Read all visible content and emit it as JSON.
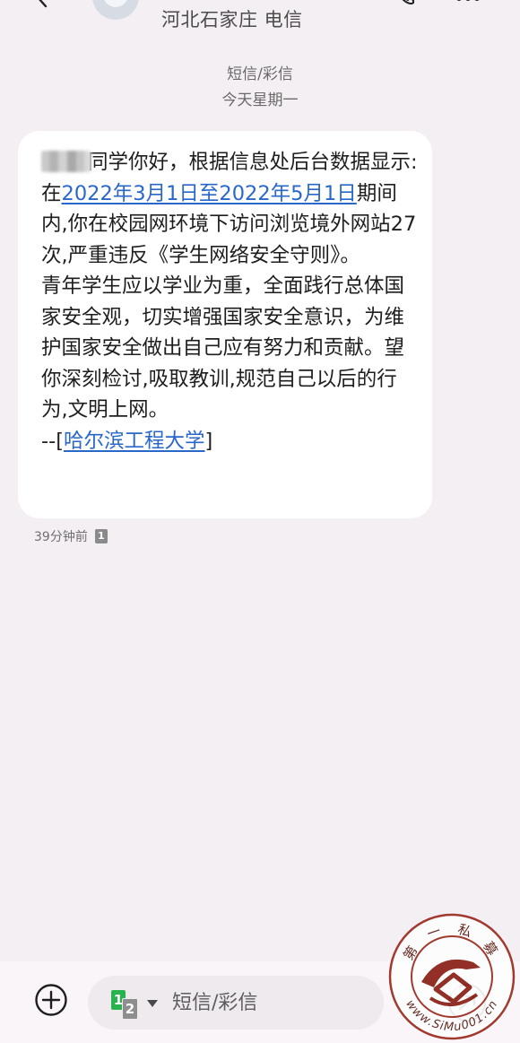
{
  "header": {
    "contact_name": "河北石家庄 电信"
  },
  "conversation": {
    "message_type": "短信/彩信",
    "date_label": "今天星期一"
  },
  "message": {
    "segments": [
      {
        "text": "同学你好，根据信息处后台数据显示:在",
        "link": false
      },
      {
        "text": "2022年3月1日至2022年5月1日",
        "link": true
      },
      {
        "text": "期间内,你在校园网环境下访问浏览境外网站27次,严重违反《学生网络安全守则》。",
        "link": false
      },
      {
        "text": "\n青年学生应以学业为重，全面践行总体国家安全观，切实增强国家安全意识，为维护国家安全做出自己应有努力和贡献。望你深刻检讨,吸取教训,规范自己以后的行为,文明上网。\n--[",
        "link": false
      },
      {
        "text": "哈尔滨工程大学",
        "link": true
      },
      {
        "text": "]",
        "link": false
      }
    ],
    "timestamp": "39分钟前",
    "sim_badge": "1"
  },
  "compose": {
    "sim_primary": "1",
    "sim_secondary": "2",
    "placeholder": "短信/彩信"
  },
  "watermark": {
    "top_text": "第 一 私 募",
    "bottom_text": "www.SiMu001.cn"
  },
  "icons": {
    "back": "back-arrow-icon",
    "call": "phone-icon",
    "more": "more-vertical-icon",
    "add": "add-circle-icon",
    "send": "send-icon"
  },
  "colors": {
    "background": "#f4eff3",
    "link": "#2967c9",
    "sim1": "#29b34e"
  }
}
